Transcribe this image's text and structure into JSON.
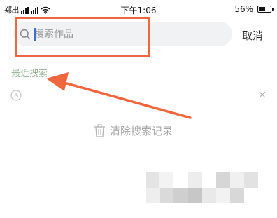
{
  "status_bar": {
    "carrier": "郑出",
    "time": "下午1:06",
    "battery_percent": "56%",
    "battery_level": 0.56
  },
  "search": {
    "placeholder": "搜索作品",
    "value": ""
  },
  "cancel_label": "取消",
  "recent_searches": {
    "title": "最近搜索",
    "items": [
      ""
    ]
  },
  "clear_history_label": "清除搜索记录",
  "colors": {
    "accent_orange": "#f0663d",
    "cursor_blue": "#3a6fd8",
    "section_title_green": "#8fae8f",
    "search_background": "#f1f2f4"
  }
}
